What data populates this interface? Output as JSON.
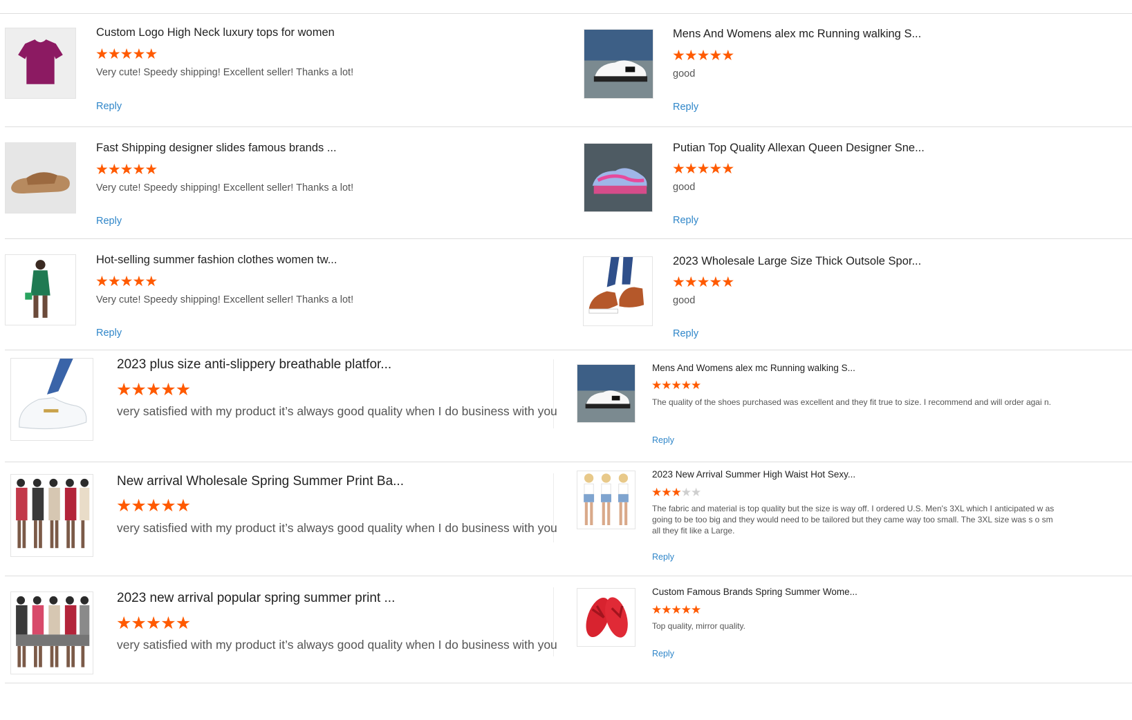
{
  "reviews": [
    {
      "title": "Custom Logo High Neck luxury tops for women",
      "rating": 5,
      "comment": "Very cute! Speedy shipping! Excellent seller! Thanks a lot!",
      "reply": "Reply",
      "image": "purple-crop-top"
    },
    {
      "title": "Mens And Womens alex mc Running walking S...",
      "rating": 5,
      "comment": "good",
      "reply": "Reply",
      "image": "white-black-sneaker"
    },
    {
      "title": "Fast Shipping designer slides famous brands ...",
      "rating": 5,
      "comment": "Very cute! Speedy shipping! Excellent seller! Thanks a lot!",
      "reply": "Reply",
      "image": "brown-slide-sandal"
    },
    {
      "title": "Putian Top Quality Allexan Queen Designer Sne...",
      "rating": 5,
      "comment": "good",
      "reply": "Reply",
      "image": "iridescent-sneaker"
    },
    {
      "title": "Hot-selling summer fashion clothes women tw...",
      "rating": 5,
      "comment": "Very cute! Speedy shipping! Excellent seller! Thanks a lot!",
      "reply": "Reply",
      "image": "green-two-piece-outfit"
    },
    {
      "title": "2023 Wholesale Large Size Thick Outsole Spor...",
      "rating": 5,
      "comment": "good",
      "reply": "Reply",
      "image": "brown-platform-loafer"
    },
    {
      "title": "2023 plus size anti-slippery breathable platfor...",
      "rating": 5,
      "comment": "very satisfied with my product it’s always good quality when I do business with you",
      "reply": "",
      "image": "white-platform-loafer"
    },
    {
      "title": "Mens And Womens alex mc Running walking S...",
      "rating": 5,
      "comment": "The quality of the shoes purchased was excellent and they fit true to size. I recommend and will order agai n.",
      "reply": "Reply",
      "image": "white-black-sneaker"
    },
    {
      "title": "New arrival Wholesale Spring Summer Print Ba...",
      "rating": 5,
      "comment": "very satisfied with my product it’s always good quality when I do business with you",
      "reply": "",
      "image": "printed-outfit-group"
    },
    {
      "title": "2023 New Arrival Summer High Waist Hot Sexy...",
      "rating": 3,
      "comment": "The fabric and material is top quality but the size is way off.  I ordered U.S. Men's 3XL which I anticipated w as going to be too big and they would need to be tailored but they came way too small.  The 3XL size was s o small they fit like a Large.",
      "reply": "Reply",
      "image": "denim-shorts-models"
    },
    {
      "title": "2023 new arrival popular spring summer print ...",
      "rating": 5,
      "comment": "very satisfied with my product it’s always good quality when I do business with you",
      "reply": "",
      "image": "printed-outfit-group"
    },
    {
      "title": "Custom Famous Brands Spring Summer Wome...",
      "rating": 5,
      "comment": "Top quality, mirror quality.",
      "reply": "Reply",
      "image": "red-flip-flops"
    }
  ],
  "colors": {
    "star": "#ff5a00",
    "star_empty": "#cfcfcf",
    "reply_link": "#2f86c9",
    "divider": "#dddddd"
  }
}
